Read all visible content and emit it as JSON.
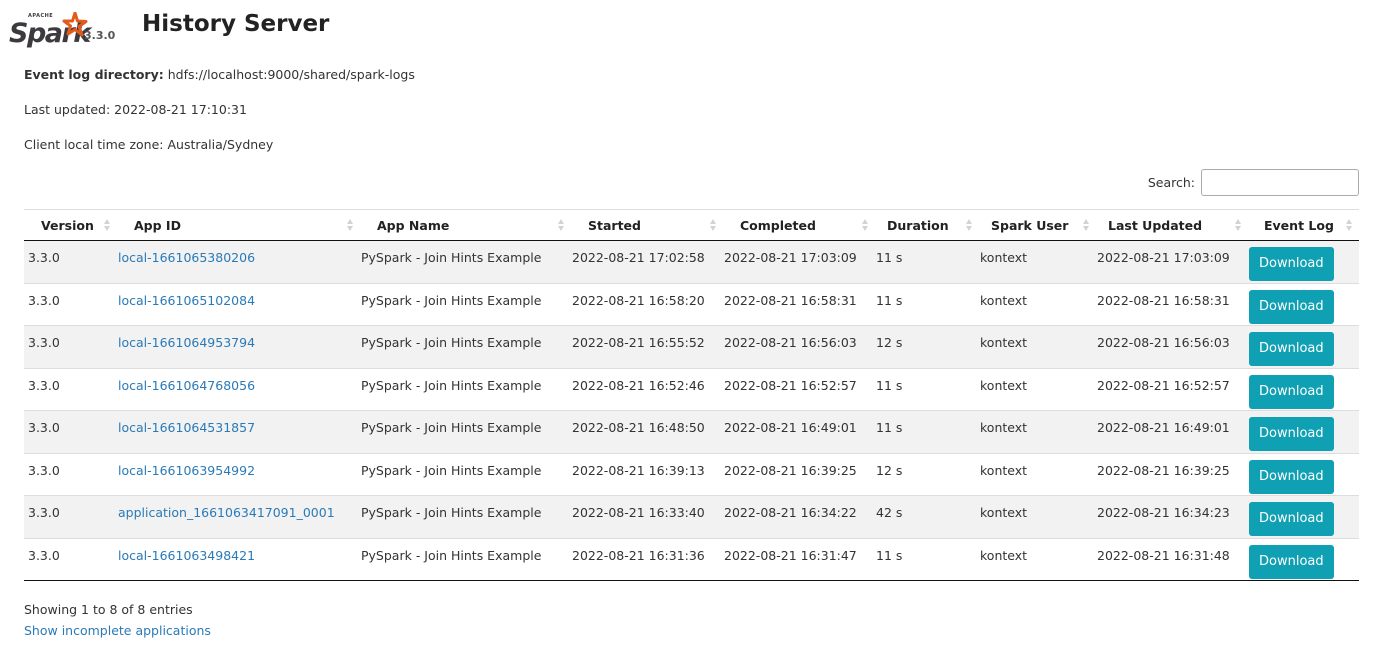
{
  "header": {
    "logo_top_text": "APACHE",
    "logo_text": "Spark",
    "version": "3.3.0",
    "title": "History Server"
  },
  "info": {
    "event_log_label": "Event log directory:",
    "event_log_value": "hdfs://localhost:9000/shared/spark-logs",
    "last_updated": "Last updated: 2022-08-21 17:10:31",
    "timezone": "Client local time zone: Australia/Sydney"
  },
  "search": {
    "label": "Search:",
    "value": "",
    "placeholder": ""
  },
  "colors": {
    "link": "#2a7ab8",
    "button": "#0fa0b3",
    "row_stripe": "#f2f2f2"
  },
  "table": {
    "columns": [
      "Version",
      "App ID",
      "App Name",
      "Started",
      "Completed",
      "Duration",
      "Spark User",
      "Last Updated",
      "Event Log"
    ],
    "rows": [
      {
        "version": "3.3.0",
        "app_id": "local-1661065380206",
        "app_name": "PySpark - Join Hints Example",
        "started": "2022-08-21 17:02:58",
        "completed": "2022-08-21 17:03:09",
        "duration": "11 s",
        "user": "kontext",
        "last_updated": "2022-08-21 17:03:09",
        "event_log": "Download"
      },
      {
        "version": "3.3.0",
        "app_id": "local-1661065102084",
        "app_name": "PySpark - Join Hints Example",
        "started": "2022-08-21 16:58:20",
        "completed": "2022-08-21 16:58:31",
        "duration": "11 s",
        "user": "kontext",
        "last_updated": "2022-08-21 16:58:31",
        "event_log": "Download"
      },
      {
        "version": "3.3.0",
        "app_id": "local-1661064953794",
        "app_name": "PySpark - Join Hints Example",
        "started": "2022-08-21 16:55:52",
        "completed": "2022-08-21 16:56:03",
        "duration": "12 s",
        "user": "kontext",
        "last_updated": "2022-08-21 16:56:03",
        "event_log": "Download"
      },
      {
        "version": "3.3.0",
        "app_id": "local-1661064768056",
        "app_name": "PySpark - Join Hints Example",
        "started": "2022-08-21 16:52:46",
        "completed": "2022-08-21 16:52:57",
        "duration": "11 s",
        "user": "kontext",
        "last_updated": "2022-08-21 16:52:57",
        "event_log": "Download"
      },
      {
        "version": "3.3.0",
        "app_id": "local-1661064531857",
        "app_name": "PySpark - Join Hints Example",
        "started": "2022-08-21 16:48:50",
        "completed": "2022-08-21 16:49:01",
        "duration": "11 s",
        "user": "kontext",
        "last_updated": "2022-08-21 16:49:01",
        "event_log": "Download"
      },
      {
        "version": "3.3.0",
        "app_id": "local-1661063954992",
        "app_name": "PySpark - Join Hints Example",
        "started": "2022-08-21 16:39:13",
        "completed": "2022-08-21 16:39:25",
        "duration": "12 s",
        "user": "kontext",
        "last_updated": "2022-08-21 16:39:25",
        "event_log": "Download"
      },
      {
        "version": "3.3.0",
        "app_id": "application_1661063417091_0001",
        "app_name": "PySpark - Join Hints Example",
        "started": "2022-08-21 16:33:40",
        "completed": "2022-08-21 16:34:22",
        "duration": "42 s",
        "user": "kontext",
        "last_updated": "2022-08-21 16:34:23",
        "event_log": "Download"
      },
      {
        "version": "3.3.0",
        "app_id": "local-1661063498421",
        "app_name": "PySpark - Join Hints Example",
        "started": "2022-08-21 16:31:36",
        "completed": "2022-08-21 16:31:47",
        "duration": "11 s",
        "user": "kontext",
        "last_updated": "2022-08-21 16:31:48",
        "event_log": "Download"
      }
    ]
  },
  "footer": {
    "showing": "Showing 1 to 8 of 8 entries",
    "incomplete_link": "Show incomplete applications"
  }
}
